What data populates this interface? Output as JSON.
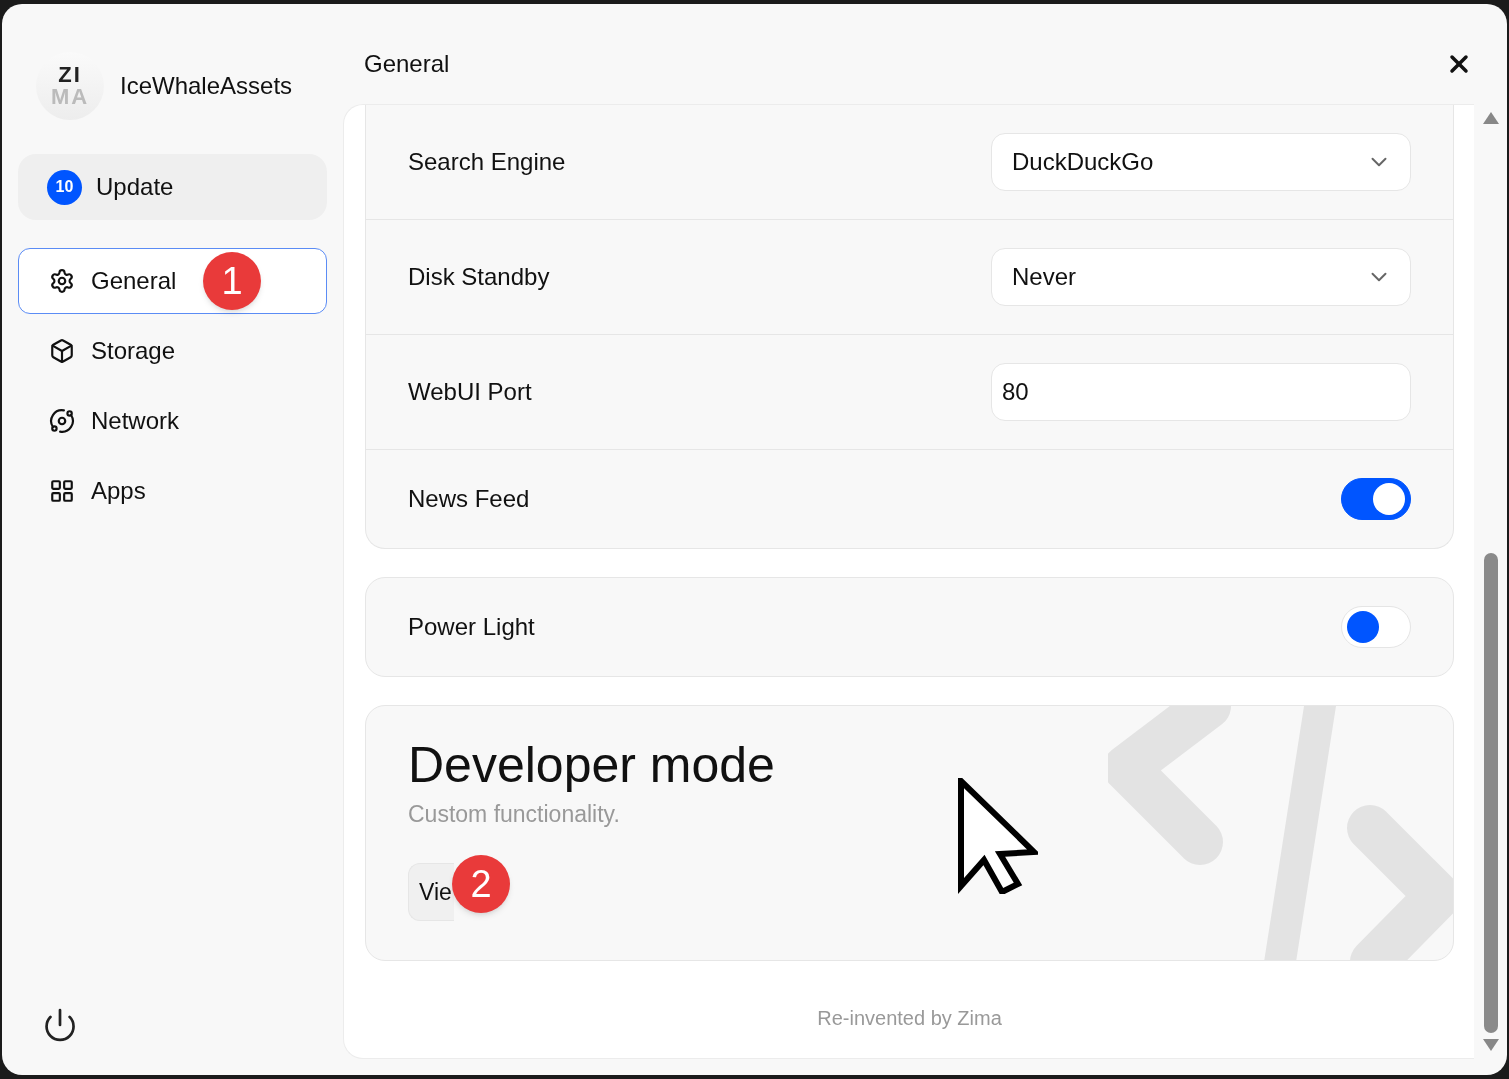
{
  "app": {
    "name": "IceWhaleAssets",
    "logo_top": "ZI",
    "logo_bottom": "MA"
  },
  "update": {
    "badge": "10",
    "label": "Update"
  },
  "sidebar": {
    "items": [
      {
        "label": "General",
        "selected": true
      },
      {
        "label": "Storage",
        "selected": false
      },
      {
        "label": "Network",
        "selected": false
      },
      {
        "label": "Apps",
        "selected": false
      }
    ]
  },
  "header": {
    "title": "General"
  },
  "settings": [
    {
      "kind": "select",
      "label": "Search Engine",
      "value": "DuckDuckGo"
    },
    {
      "kind": "select",
      "label": "Disk Standby",
      "value": "Never"
    },
    {
      "kind": "input",
      "label": "WebUI Port",
      "value": "80"
    },
    {
      "kind": "toggle",
      "label": "News Feed",
      "on": true
    }
  ],
  "power_light": {
    "label": "Power Light",
    "on": false
  },
  "developer": {
    "title": "Developer mode",
    "subtitle": "Custom functionality.",
    "button": "Vie"
  },
  "footer": "Re-invented by Zima",
  "markers": [
    "1",
    "2"
  ]
}
